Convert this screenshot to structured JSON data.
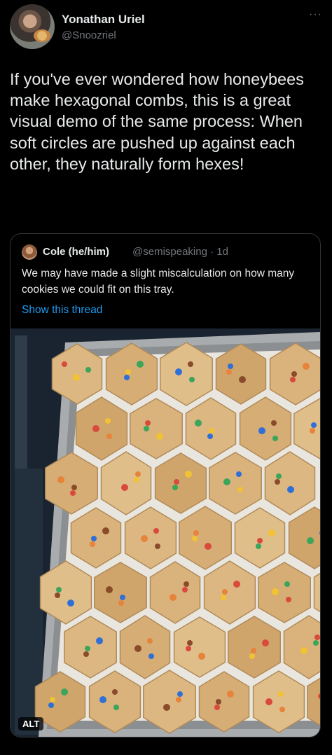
{
  "author": {
    "display_name": "Yonathan Uriel",
    "handle": "@Snoozriel",
    "avatar_icon": "user-avatar"
  },
  "more_icon_glyph": "···",
  "tweet_text": "If you've ever wondered how honeybees make hexagonal combs, this is a great visual demo of the same process: When soft circles are pushed up against each other, they naturally form hexes!",
  "quote": {
    "display_name": "Cole (he/him)",
    "handle_time": "@semispeaking · 1d",
    "text": "We may have made a slight miscalculation on how many cookies we could fit on this tray.",
    "show_thread": "Show this thread",
    "media_alt_badge": "ALT"
  },
  "colors": {
    "background": "#000000",
    "text": "#e7e9ea",
    "muted": "#71767b",
    "link": "#1d9bf0",
    "border": "#2f3336",
    "cookie": "#d9b27c",
    "tray": "#a9acae"
  }
}
